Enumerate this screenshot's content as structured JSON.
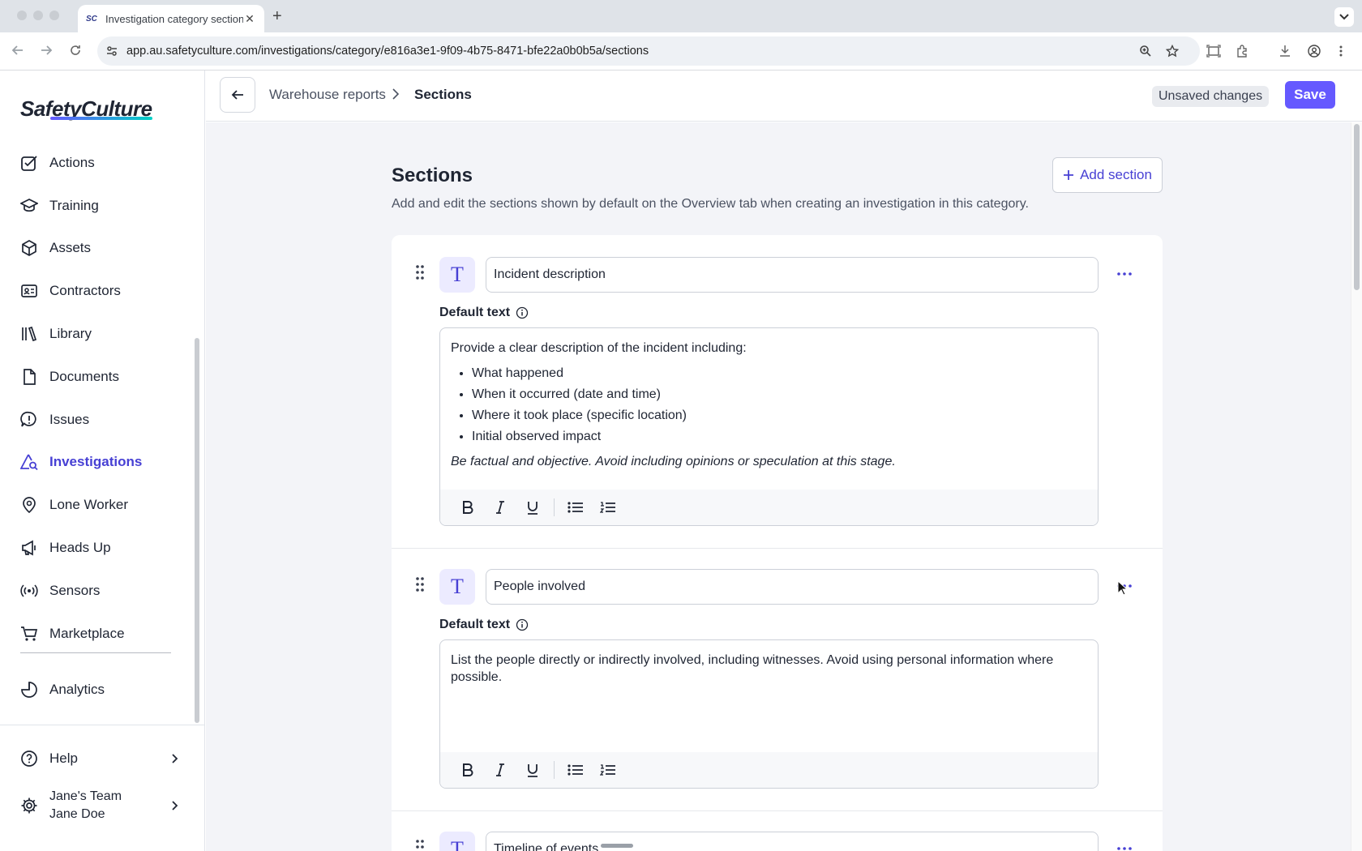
{
  "browser": {
    "tab_title": "Investigation category sections",
    "tab_favicon": "SC",
    "url": "app.au.safetyculture.com/investigations/category/e816a3e1-9f09-4b75-8471-bfe22a0b0b5a/sections"
  },
  "sidebar": {
    "logo": "SafetyCulture",
    "items": [
      {
        "label": "Actions",
        "icon": "checkbox-icon"
      },
      {
        "label": "Training",
        "icon": "graduation-cap-icon"
      },
      {
        "label": "Assets",
        "icon": "cube-icon"
      },
      {
        "label": "Contractors",
        "icon": "id-card-icon"
      },
      {
        "label": "Library",
        "icon": "books-icon"
      },
      {
        "label": "Documents",
        "icon": "document-icon"
      },
      {
        "label": "Issues",
        "icon": "issue-icon"
      },
      {
        "label": "Investigations",
        "icon": "investigation-icon",
        "active": true
      },
      {
        "label": "Lone Worker",
        "icon": "map-pin-icon"
      },
      {
        "label": "Heads Up",
        "icon": "megaphone-icon"
      },
      {
        "label": "Sensors",
        "icon": "sensor-icon"
      },
      {
        "label": "Marketplace",
        "icon": "cart-icon"
      },
      {
        "label": "Analytics",
        "icon": "pie-chart-icon"
      }
    ],
    "help_label": "Help",
    "team_name": "Jane's Team",
    "user_name": "Jane Doe"
  },
  "header": {
    "breadcrumb_parent": "Warehouse reports",
    "breadcrumb_current": "Sections",
    "unsaved_label": "Unsaved changes",
    "save_label": "Save"
  },
  "page": {
    "title": "Sections",
    "subtitle": "Add and edit the sections shown by default on the Overview tab when creating an investigation in this category.",
    "add_section_label": "Add section"
  },
  "sections": [
    {
      "title": "Incident description",
      "default_text_label": "Default text",
      "intro": "Provide a clear description of the incident including:",
      "bullets": [
        "What happened",
        "When it occurred (date and time)",
        "Where it took place (specific location)",
        "Initial observed impact"
      ],
      "note": "Be factual and objective. Avoid including opinions or speculation at this stage."
    },
    {
      "title": "People involved",
      "default_text_label": "Default text",
      "intro": "List the people directly or indirectly involved, including witnesses. Avoid using personal information where possible."
    },
    {
      "title": "Timeline of events"
    }
  ],
  "colors": {
    "accent": "#6559ff",
    "accent_text": "#4740d4",
    "content_bg": "#f3f4f8"
  }
}
